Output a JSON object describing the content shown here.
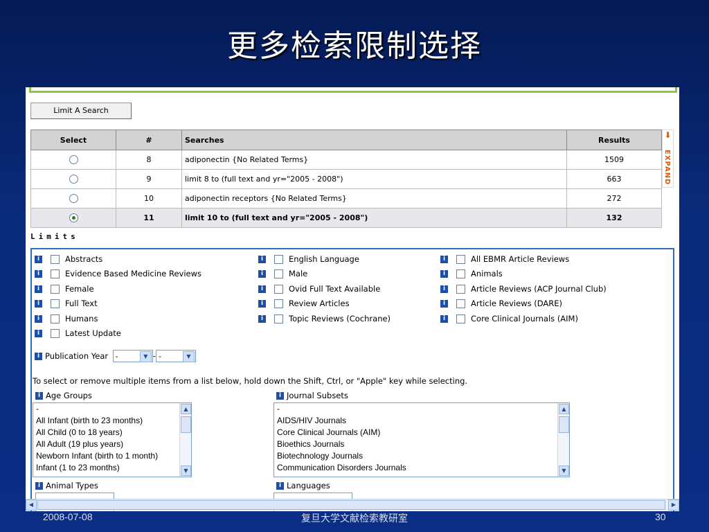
{
  "slide": {
    "title": "更多检索限制选择",
    "footer_date": "2008-07-08",
    "footer_center": "复旦大学文献检索教研室",
    "footer_page": "30"
  },
  "limit_button": "Limit A Search",
  "history": {
    "headers": {
      "select": "Select",
      "num": "#",
      "searches": "Searches",
      "results": "Results"
    },
    "rows": [
      {
        "num": "8",
        "search": "adiponectin {No Related Terms}",
        "results": "1509",
        "selected": false
      },
      {
        "num": "9",
        "search": "limit 8 to (full text and yr=\"2005 - 2008\")",
        "results": "663",
        "selected": false
      },
      {
        "num": "10",
        "search": "adiponectin receptors {No Related Terms}",
        "results": "272",
        "selected": false
      },
      {
        "num": "11",
        "search": "limit 10 to (full text and yr=\"2005 - 2008\")",
        "results": "132",
        "selected": true
      }
    ],
    "expand_label": "EXPAND"
  },
  "limits": {
    "heading": "Limits",
    "col1": [
      "Abstracts",
      "Evidence Based Medicine Reviews",
      "Female",
      "Full Text",
      "Humans",
      "Latest Update"
    ],
    "col2": [
      "English Language",
      "Male",
      "Ovid Full Text Available",
      "Review Articles",
      "Topic Reviews (Cochrane)"
    ],
    "col3": [
      "All EBMR Article Reviews",
      "Animals",
      "Article Reviews (ACP Journal Club)",
      "Article Reviews (DARE)",
      "Core Clinical Journals (AIM)"
    ],
    "pub_year_label": "Publication Year",
    "pub_year_from": "-",
    "pub_year_to": "-",
    "hint": "To select or remove multiple items from a list below, hold down the Shift, Ctrl, or \"Apple\" key while selecting.",
    "age_groups_label": "Age Groups",
    "age_groups": [
      "-",
      "All Infant (birth to 23 months)",
      "All Child (0 to 18 years)",
      "All Adult (19 plus years)",
      "Newborn Infant (birth to 1 month)",
      "Infant (1 to 23 months)"
    ],
    "journal_subsets_label": "Journal Subsets",
    "journal_subsets": [
      "-",
      "AIDS/HIV Journals",
      "Core Clinical Journals (AIM)",
      "Bioethics Journals",
      "Biotechnology Journals",
      "Communication Disorders Journals"
    ],
    "animal_types_label": "Animal Types",
    "languages_label": "Languages"
  }
}
